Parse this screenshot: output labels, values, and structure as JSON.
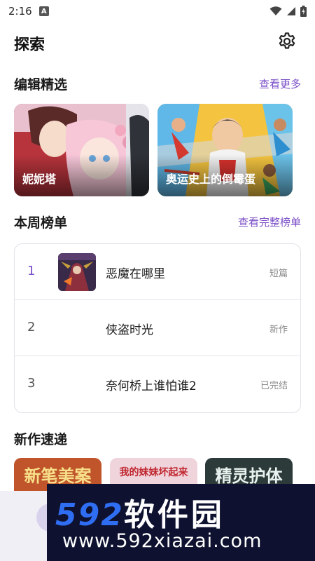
{
  "status_bar": {
    "time": "2:16",
    "badge": "A"
  },
  "header": {
    "title": "探索"
  },
  "editor_picks": {
    "title": "编辑精选",
    "more": "查看更多",
    "items": [
      {
        "label": "妮妮塔"
      },
      {
        "label": "奥运史上的倒霉蛋"
      }
    ]
  },
  "weekly_rank": {
    "title": "本周榜单",
    "more": "查看完整榜单",
    "items": [
      {
        "rank": "1",
        "title": "恶魔在哪里",
        "tag": "短篇"
      },
      {
        "rank": "2",
        "title": "侠盗时光",
        "tag": "新作"
      },
      {
        "rank": "3",
        "title": "奈何桥上谁怕谁2",
        "tag": "已完结"
      }
    ]
  },
  "new_works": {
    "title": "新作速递",
    "items": [
      {
        "cover_text": "新笔美案"
      },
      {
        "cover_text": "我的妹妹坏起来"
      },
      {
        "cover_text": "精灵护体"
      }
    ]
  },
  "watermark": {
    "brand": "592",
    "brand_cn": "软件园",
    "url": "www.592xiazai.com"
  },
  "colors": {
    "accent": "#7b4fc8",
    "banner_bg": "#0e1230",
    "banner_blue": "#2f6df2"
  }
}
